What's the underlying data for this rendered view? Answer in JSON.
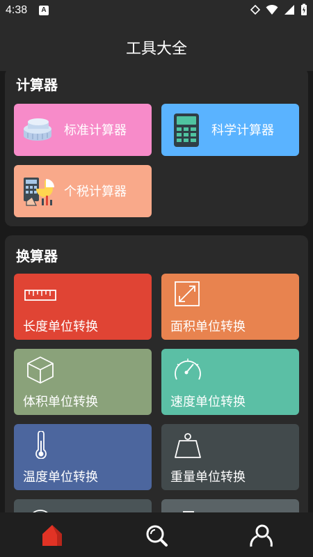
{
  "status_bar": {
    "time": "4:38",
    "badge": "A"
  },
  "app_bar": {
    "title": "工具大全"
  },
  "calculators": {
    "title": "计算器",
    "items": [
      {
        "label": "标准计算器",
        "color": "#f78bc9",
        "icon": "coin-stack-icon"
      },
      {
        "label": "科学计算器",
        "color": "#5ab3ff",
        "icon": "calculator-icon"
      },
      {
        "label": "个税计算器",
        "color": "#f9a98a",
        "icon": "tax-chart-icon"
      }
    ]
  },
  "converters": {
    "title": "换算器",
    "items": [
      {
        "label": "长度单位转换",
        "color": "#e04434",
        "icon": "ruler-icon"
      },
      {
        "label": "面积单位转换",
        "color": "#e8834f",
        "icon": "area-arrow-icon"
      },
      {
        "label": "体积单位转换",
        "color": "#8aa27a",
        "icon": "cube-icon"
      },
      {
        "label": "速度单位转换",
        "color": "#5bbfa5",
        "icon": "speedometer-icon"
      },
      {
        "label": "温度单位转换",
        "color": "#4c669e",
        "icon": "thermometer-icon"
      },
      {
        "label": "重量单位转换",
        "color": "#424a4c",
        "icon": "weight-icon"
      }
    ]
  },
  "bottom_nav": [
    {
      "name": "home",
      "icon": "home-icon",
      "active": true
    },
    {
      "name": "search",
      "icon": "search-icon",
      "active": false
    },
    {
      "name": "profile",
      "icon": "user-icon",
      "active": false
    }
  ]
}
